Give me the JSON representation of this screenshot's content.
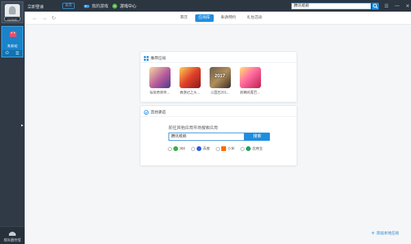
{
  "sidebar": {
    "profile_badge": "CLOUD",
    "app_tile_label": "未启动",
    "bottom_label": "模拟器管理",
    "collapse_arrow": "▸"
  },
  "topbar": {
    "title": "立即登录",
    "vip_label": "会员",
    "nav": [
      {
        "label": "我的游戏",
        "icon": "gamepad-icon"
      },
      {
        "label": "游戏中心",
        "icon": "android-icon"
      }
    ],
    "search_value": "腾讯视频",
    "window_controls": [
      "☰",
      "—",
      "✕"
    ]
  },
  "toolbar": {
    "back": "←",
    "forward": "→",
    "refresh": "↻",
    "tabs": [
      {
        "label": "首页",
        "active": false
      },
      {
        "label": "应用库",
        "active": true
      },
      {
        "label": "新游预约",
        "active": false
      },
      {
        "label": "礼包活动",
        "active": false
      }
    ]
  },
  "recommended": {
    "title": "推荐应用",
    "apps": [
      {
        "name": "仙剑奇侠传...",
        "thumb_text": ""
      },
      {
        "name": "西游记之大...",
        "thumb_text": ""
      },
      {
        "name": "三国志201...",
        "thumb_text": "2017"
      },
      {
        "name": "妖精的尾巴...",
        "thumb_text": ""
      }
    ]
  },
  "other_channels": {
    "title": "其他渠道",
    "hint": "前往其他应用市场搜索应用",
    "search_value": "腾讯视频",
    "search_button": "搜索",
    "stores": [
      {
        "label": "360",
        "color": "#3cb043"
      },
      {
        "label": "百度",
        "color": "#2d5be3"
      },
      {
        "label": "小米",
        "color": "#ff6a00"
      },
      {
        "label": "应用宝",
        "color": "#1fa35c"
      }
    ]
  },
  "footer": {
    "add_local": "添加本地应用"
  },
  "colors": {
    "accent": "#1f8ee0",
    "sidebar_bg": "#2f3a46",
    "topbar_bg": "#2b3641"
  }
}
